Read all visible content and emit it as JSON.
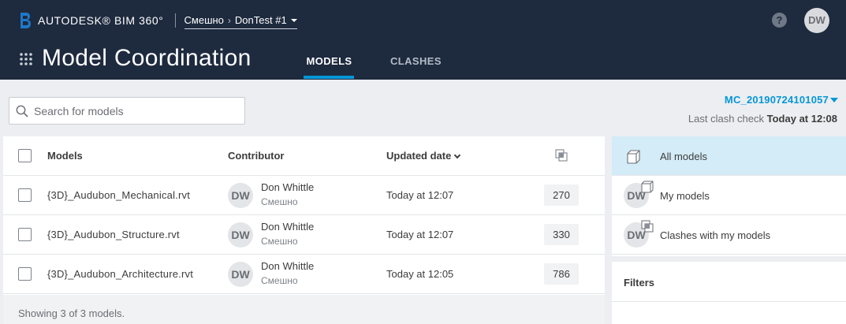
{
  "header": {
    "brand": "AUTODESK® BIM 360°",
    "project_org": "Смешно",
    "project_name": "DonTest #1",
    "help_label": "?",
    "user_initials": "DW",
    "app_title": "Model Coordination",
    "tabs": [
      {
        "label": "MODELS",
        "active": true
      },
      {
        "label": "CLASHES",
        "active": false
      }
    ]
  },
  "toolbar": {
    "search_placeholder": "Search for models",
    "search_value": "",
    "version": "MC_20190724101057",
    "last_check_label": "Last clash check",
    "last_check_value": "Today at 12:08"
  },
  "table": {
    "columns": {
      "models": "Models",
      "contributor": "Contributor",
      "updated": "Updated date"
    },
    "rows": [
      {
        "name": "{3D}_Audubon_Mechanical.rvt",
        "initials": "DW",
        "contributor": "Don Whittle",
        "org": "Смешно",
        "updated": "Today at 12:07",
        "clashes": "270"
      },
      {
        "name": "{3D}_Audubon_Structure.rvt",
        "initials": "DW",
        "contributor": "Don Whittle",
        "org": "Смешно",
        "updated": "Today at 12:07",
        "clashes": "330"
      },
      {
        "name": "{3D}_Audubon_Architecture.rvt",
        "initials": "DW",
        "contributor": "Don Whittle",
        "org": "Смешно",
        "updated": "Today at 12:05",
        "clashes": "786"
      }
    ],
    "footer": "Showing 3 of 3 models."
  },
  "panel": {
    "items": [
      {
        "label": "All models",
        "active": true
      },
      {
        "label": "My models",
        "initials": "DW"
      },
      {
        "label": "Clashes with my models",
        "initials": "DW"
      }
    ],
    "filters_title": "Filters"
  },
  "colors": {
    "header_bg": "#1e2a3e",
    "accent": "#0696d7",
    "active_row": "#d3ecf7"
  }
}
